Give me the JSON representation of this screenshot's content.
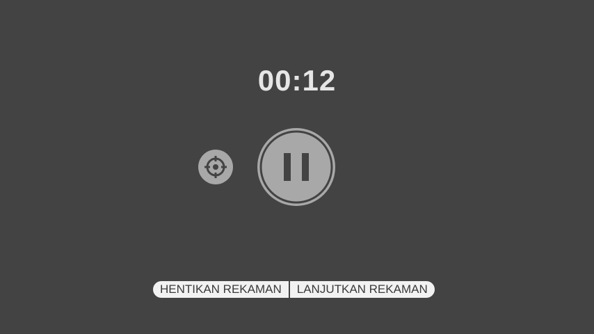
{
  "recorder": {
    "timer": "00:12",
    "state_icon": "pause-icon",
    "target_icon": "crosshair-icon"
  },
  "actions": {
    "stop_label": "HENTIKAN REKAMAN",
    "resume_label": "LANJUTKAN REKAMAN"
  },
  "colors": {
    "background": "#434343",
    "control": "#a8a8a8",
    "timer_text": "#e6e6e6",
    "pill_bg": "#f2f2f2"
  }
}
